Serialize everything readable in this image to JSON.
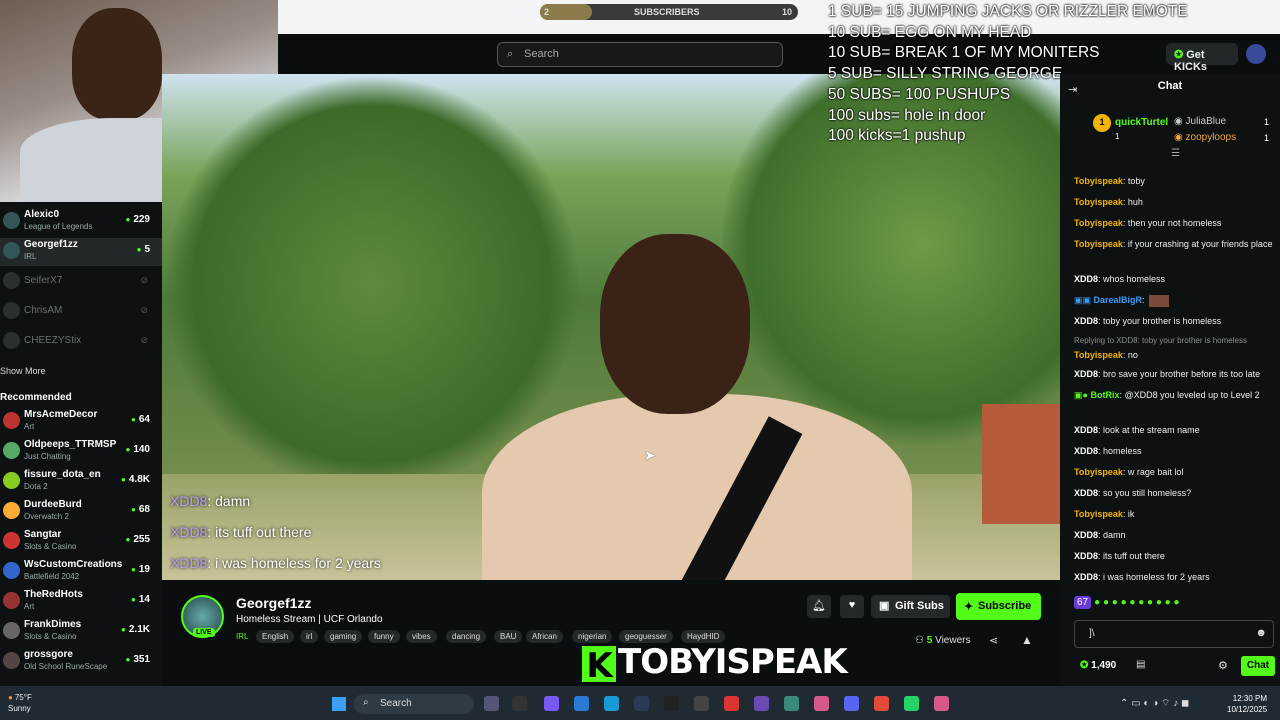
{
  "topbar": {
    "sub_goal": {
      "current": "2",
      "label": "SUBSCRIBERS",
      "target": "10",
      "progress_fraction": 0.2
    }
  },
  "header": {
    "search_placeholder": "Search",
    "get_kicks_label": "Get KICKs"
  },
  "overlay": {
    "goals": [
      "1 SUB= 15 JUMPING JACKS OR RIZZLER EMOTE",
      "10 SUB= EGG ON MY HEAD",
      "10 SUB= BREAK 1 OF MY MONITERS",
      "5 SUB= SILLY STRING GEORGE",
      "50 SUBS= 100 PUSHUPS",
      "100 subs= hole in door",
      "100 kicks=1 pushup"
    ],
    "chat_lines": [
      {
        "user": "XDD8",
        "text": ": damn"
      },
      {
        "user": "XDD8",
        "text": ": its tuff out there"
      },
      {
        "user": "XDD8",
        "text": ": i was homeless for 2 years"
      }
    ]
  },
  "sidebar": {
    "following": [
      {
        "name": "Alexic0",
        "category": "League of Legends",
        "viewers": "229",
        "online": true
      },
      {
        "name": "Georgef1zz",
        "category": "IRL",
        "viewers": "5",
        "online": true,
        "active": true
      },
      {
        "name": "SeiferX7",
        "online": false
      },
      {
        "name": "ChrisAM",
        "online": false
      },
      {
        "name": "CHEEZYStix",
        "online": false
      }
    ],
    "show_more": "Show More",
    "recommended_title": "Recommended",
    "recommended": [
      {
        "name": "MrsAcmeDecor",
        "category": "Art",
        "viewers": "64"
      },
      {
        "name": "Oldpeeps_TTRMSP",
        "category": "Just Chatting",
        "viewers": "140"
      },
      {
        "name": "fissure_dota_en",
        "category": "Dota 2",
        "viewers": "4.8K"
      },
      {
        "name": "DurdeeBurd",
        "category": "Overwatch 2",
        "viewers": "68"
      },
      {
        "name": "Sangtar",
        "category": "Slots & Casino",
        "viewers": "255"
      },
      {
        "name": "WsCustomCreations",
        "category": "Battlefield 2042",
        "viewers": "19"
      },
      {
        "name": "TheRedHots",
        "category": "Art",
        "viewers": "14"
      },
      {
        "name": "FrankDimes",
        "category": "Slots & Casino",
        "viewers": "2.1K"
      },
      {
        "name": "grossgore",
        "category": "Old School RuneScape",
        "viewers": "351"
      }
    ]
  },
  "stream": {
    "channel": "Georgef1zz",
    "live_label": "LIVE",
    "title": "Homeless Stream | UCF Orlando",
    "category": "IRL",
    "tags": [
      "English",
      "irl",
      "gaming",
      "funny",
      "vibes",
      "dancing",
      "BAU",
      "African",
      "nigerian",
      "geoguesser",
      "HaydHID"
    ],
    "gift_label": "Gift Subs",
    "subscribe_label": "Subscribe",
    "viewers_count": "5",
    "viewers_label": "Viewers",
    "watermark": "TOBYISPEAK"
  },
  "chat": {
    "title": "Chat",
    "leaders": [
      {
        "rank": "1",
        "name": "quickTurtel",
        "count": "1"
      },
      {
        "name": "JuliaBlue",
        "count": "1"
      },
      {
        "name": "zoopyloops",
        "count": "1"
      }
    ],
    "messages": [
      {
        "user": "Tobyispeak",
        "text": "toby",
        "color": "#f3b400"
      },
      {
        "user": "Tobyispeak",
        "text": "huh",
        "color": "#f3b400"
      },
      {
        "user": "Tobyispeak",
        "text": "then your not homeless",
        "color": "#f3b400"
      },
      {
        "user": "Tobyispeak",
        "text": "if your crashing at your friends place",
        "color": "#f3b400"
      },
      {
        "user": "XDD8",
        "text": "whos homeless",
        "color": "#ffffff"
      },
      {
        "user": "DarealBigR",
        "text": "",
        "color": "#3a9af5",
        "emote": true
      },
      {
        "user": "XDD8",
        "text": "toby your brother is homeless",
        "color": "#ffffff"
      },
      {
        "reply": "Replying to XDD8: toby your brother is homeless",
        "user": "Tobyispeak",
        "text": "no",
        "color": "#f3b400"
      },
      {
        "user": "XDD8",
        "text": "bro save your brother before its too late",
        "color": "#ffffff"
      },
      {
        "user": "BotRix",
        "text": "@XDD8 you leveled up to Level 2",
        "color": "#53fc18"
      },
      {
        "user": "XDD8",
        "text": "look at the stream name",
        "color": "#ffffff"
      },
      {
        "user": "XDD8",
        "text": "homeless",
        "color": "#ffffff"
      },
      {
        "user": "Tobyispeak",
        "text": "w rage bait lol",
        "color": "#f3b400"
      },
      {
        "user": "XDD8",
        "text": "so you still homeless?",
        "color": "#ffffff"
      },
      {
        "user": "Tobyispeak",
        "text": "ik",
        "color": "#f3b400"
      },
      {
        "user": "XDD8",
        "text": "damn",
        "color": "#ffffff"
      },
      {
        "user": "XDD8",
        "text": "its tuff out there",
        "color": "#ffffff"
      },
      {
        "user": "XDD8",
        "text": "i was homeless for 2 years",
        "color": "#ffffff"
      }
    ],
    "emote_count": "67",
    "input_value": "]\\",
    "kicks_balance": "1,490",
    "chat_button": "Chat"
  },
  "taskbar": {
    "temperature": "75°F",
    "weather": "Sunny",
    "search_label": "Search",
    "time": "12:30 PM",
    "date": "10/12/2025"
  }
}
